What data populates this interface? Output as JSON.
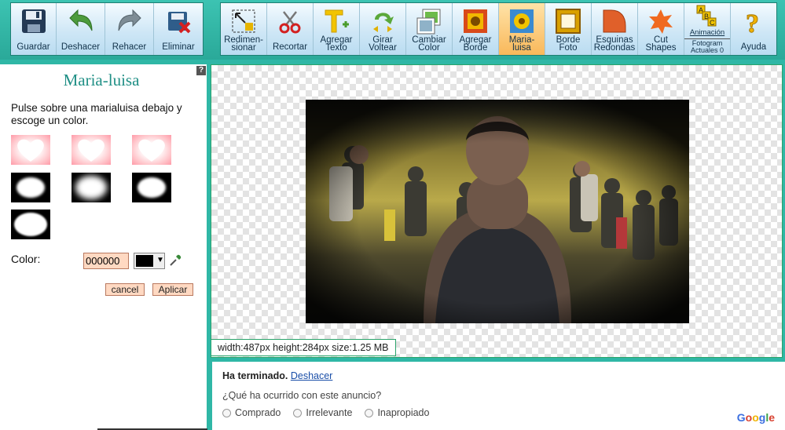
{
  "toolbar": {
    "left": [
      {
        "label": "Guardar",
        "icon": "save-icon"
      },
      {
        "label": "Deshacer",
        "icon": "undo-icon"
      },
      {
        "label": "Rehacer",
        "icon": "redo-icon"
      },
      {
        "label": "Eliminar",
        "icon": "delete-icon"
      }
    ],
    "tools": [
      {
        "l1": "Redimen-",
        "l2": "sionar",
        "icon": "resize-icon"
      },
      {
        "l1": "",
        "l2": "Recortar",
        "icon": "scissors-icon"
      },
      {
        "l1": "Agregar",
        "l2": "Texto",
        "icon": "text-icon"
      },
      {
        "l1": "Girar",
        "l2": "Voltear",
        "icon": "rotate-icon"
      },
      {
        "l1": "Cambiar",
        "l2": "Color",
        "icon": "color-icon"
      },
      {
        "l1": "Agregar",
        "l2": "Borde",
        "icon": "border-icon"
      },
      {
        "l1": "Maria-",
        "l2": "luisa",
        "icon": "passepartout-icon"
      },
      {
        "l1": "Borde",
        "l2": "Foto",
        "icon": "frame-icon"
      },
      {
        "l1": "Esquinas",
        "l2": "Redondas",
        "icon": "round-corners-icon"
      },
      {
        "l1": "Cut",
        "l2": "Shapes",
        "icon": "shapes-icon"
      },
      {
        "l1": "Animación",
        "l2": "Fotogram",
        "l3": "Actuales 0",
        "icon": "animation-icon"
      },
      {
        "l1": "",
        "l2": "Ayuda",
        "icon": "help-icon"
      }
    ]
  },
  "panel": {
    "help": "?",
    "title": "Maria-luisa",
    "description": "Pulse sobre una marialuisa debajo y escoge un color.",
    "color_label": "Color:",
    "color_value": "000000",
    "selected_color": "#000000",
    "cancel_label": "cancel",
    "apply_label": "Aplicar"
  },
  "canvas": {
    "status": "width:487px  height:284px  size:1.25 MB"
  },
  "ad": {
    "done": "Ha terminado.",
    "undo": "Deshacer",
    "question": "¿Qué ha ocurrido con este anuncio?",
    "options": [
      "Comprado",
      "Irrelevante",
      "Inapropiado"
    ],
    "brand": "Google"
  },
  "colors": {
    "accent": "#2fb7a6",
    "active_tool": "#f9b85a",
    "input_bg": "#ffd9c2"
  }
}
